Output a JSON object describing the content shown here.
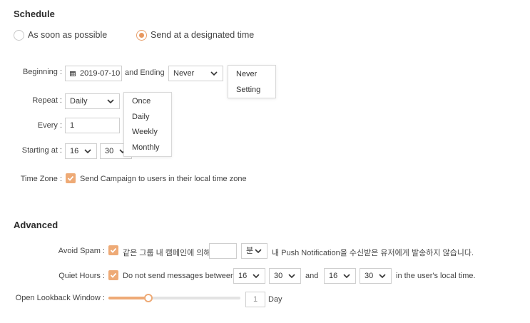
{
  "schedule": {
    "title": "Schedule",
    "radio_asap": "As soon as possible",
    "radio_designated": "Send at a designated time",
    "selected": "designated"
  },
  "beginning": {
    "label": "Beginning :",
    "date": "2019-07-10",
    "and_ending": "and Ending",
    "ending_value": "Never",
    "ending_options": [
      "Never",
      "Setting"
    ]
  },
  "repeat": {
    "label": "Repeat :",
    "value": "Daily",
    "options": [
      "Once",
      "Daily",
      "Weekly",
      "Monthly"
    ]
  },
  "every": {
    "label": "Every :",
    "value": "1"
  },
  "starting_at": {
    "label": "Starting at :",
    "hour": "16",
    "minute": "30"
  },
  "time_zone": {
    "label": "Time Zone :",
    "checked": true,
    "text": "Send Campaign to users in their local time zone"
  },
  "advanced": {
    "title": "Advanced",
    "avoid_spam": {
      "label": "Avoid Spam :",
      "checked": true,
      "text_before": "같은 그룹 내 캠페인에 의해",
      "input_value": "",
      "unit": "분",
      "text_after": "내 Push Notification을 수신받은 유저에게 발송하지 않습니다."
    },
    "quiet_hours": {
      "label": "Quiet Hours :",
      "checked": true,
      "text_before": "Do not send messages between",
      "from_hour": "16",
      "from_minute": "30",
      "and": "and",
      "to_hour": "16",
      "to_minute": "30",
      "text_after": "in the user's local time."
    },
    "lookback": {
      "label": "Open Lookback Window :",
      "slider_fraction": 0.3,
      "value": "1",
      "unit": "Day"
    }
  },
  "colors": {
    "accent": "#eeaa76",
    "border": "#cfcfcf"
  }
}
